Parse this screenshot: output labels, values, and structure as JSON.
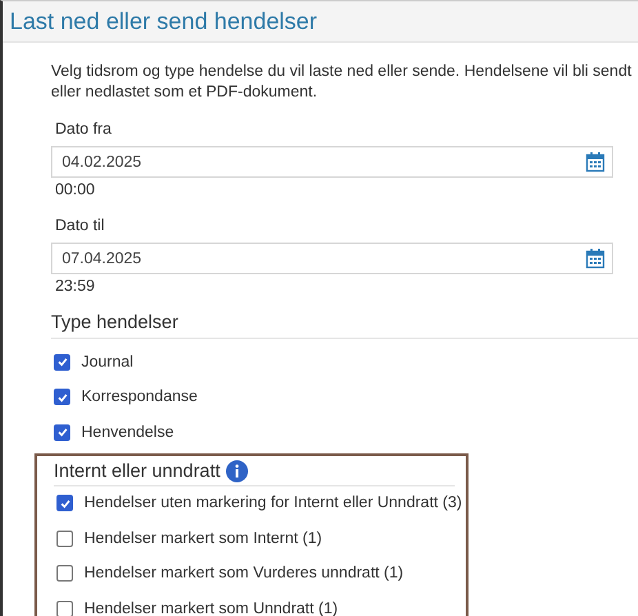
{
  "title": "Last ned eller send hendelser",
  "description": "Velg tidsrom og type hendelse du vil laste ned eller sende. Hendelsene vil bli sendt eller nedlastet som et PDF-dokument.",
  "date_fields": [
    {
      "label": "Dato fra",
      "value": "04.02.2025",
      "time": "00:00"
    },
    {
      "label": "Dato til",
      "value": "07.04.2025",
      "time": "23:59"
    }
  ],
  "event_types": {
    "heading": "Type hendelser",
    "options": [
      {
        "label": "Journal",
        "checked": true
      },
      {
        "label": "Korrespondanse",
        "checked": true
      },
      {
        "label": "Henvendelse",
        "checked": true
      }
    ]
  },
  "internal_or_exempt": {
    "heading": "Internt eller unndratt",
    "highlighted": true,
    "options": [
      {
        "label": "Hendelser uten markering for Internt eller Unndratt (3)",
        "checked": true
      },
      {
        "label": "Hendelser markert som Internt (1)",
        "checked": false
      },
      {
        "label": "Hendelser markert som Vurderes unndratt (1)",
        "checked": false
      },
      {
        "label": "Hendelser markert som Unndratt (1)",
        "checked": false
      }
    ]
  }
}
